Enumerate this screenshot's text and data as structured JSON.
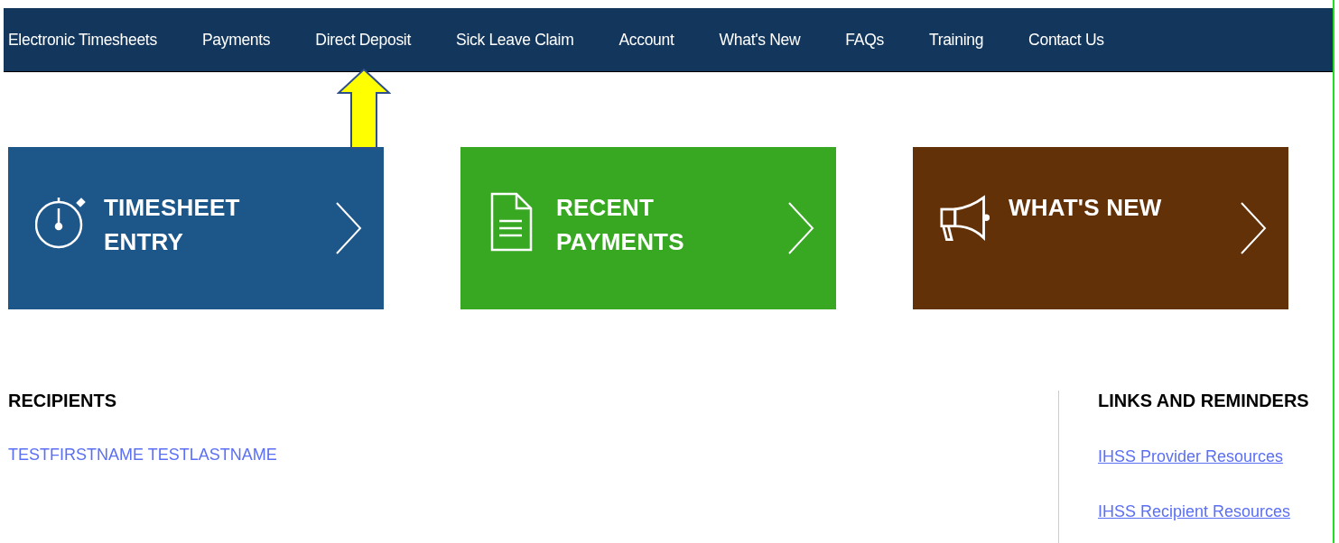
{
  "nav": {
    "items": [
      {
        "label": "Electronic Timesheets"
      },
      {
        "label": "Payments"
      },
      {
        "label": "Direct Deposit"
      },
      {
        "label": "Sick Leave Claim"
      },
      {
        "label": "Account"
      },
      {
        "label": "What's New"
      },
      {
        "label": "FAQs"
      },
      {
        "label": "Training"
      },
      {
        "label": "Contact Us"
      }
    ]
  },
  "tiles": [
    {
      "kind": "stopwatch",
      "title": "TIMESHEET ENTRY",
      "color": "#1d578a"
    },
    {
      "kind": "document",
      "title": "RECENT PAYMENTS",
      "color": "#38a822"
    },
    {
      "kind": "megaphone",
      "title": "WHAT'S NEW",
      "color": "#623108"
    }
  ],
  "recipients": {
    "heading": "RECIPIENTS",
    "items": [
      "TESTFIRSTNAME TESTLASTNAME"
    ]
  },
  "links": {
    "heading": "LINKS AND REMINDERS",
    "items": [
      "IHSS Provider Resources",
      "IHSS Recipient Resources"
    ]
  }
}
